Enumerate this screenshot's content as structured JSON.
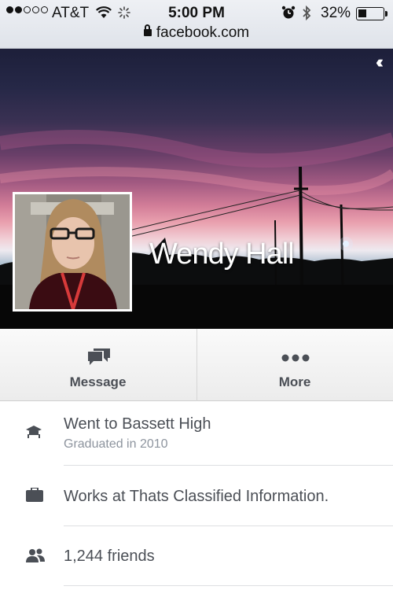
{
  "status_bar": {
    "carrier": "AT&T",
    "time": "5:00 PM",
    "battery_percent": "32%",
    "battery_level": 0.32,
    "signal_bars_filled": 2,
    "signal_bars_total": 5
  },
  "browser": {
    "url": "facebook.com"
  },
  "profile": {
    "name": "Wendy Hall"
  },
  "actions": {
    "message_label": "Message",
    "more_label": "More"
  },
  "info": {
    "education": {
      "title": "Went to Bassett High",
      "subtitle": "Graduated in 2010"
    },
    "work": {
      "title": "Works at Thats Classified Information."
    },
    "friends": {
      "title": "1,244 friends"
    }
  },
  "colors": {
    "text_primary": "#4b4f56",
    "text_secondary": "#8d949e",
    "icon": "#4b4f56"
  },
  "icons": [
    "wifi-icon",
    "activity-spinner-icon",
    "alarm-icon",
    "bluetooth-icon",
    "battery-icon",
    "lock-icon",
    "collapse-chevrons-icon",
    "message-icon",
    "more-icon",
    "education-icon",
    "work-icon",
    "friends-icon"
  ]
}
